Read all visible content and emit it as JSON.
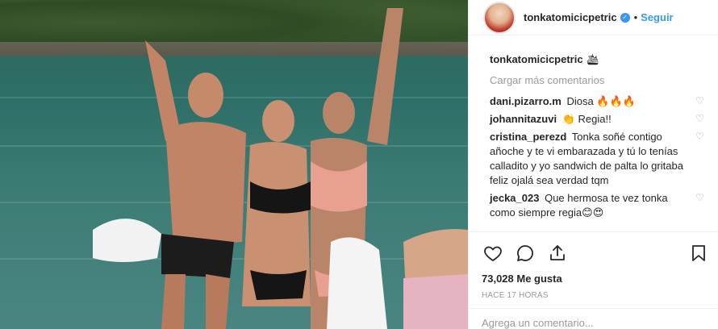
{
  "post": {
    "username": "tonkatomicicpetric",
    "follow_label": "Seguir",
    "dot": "•",
    "caption_username": "tonkatomicicpetric",
    "caption_text": "🛳",
    "load_more": "Cargar más comentarios",
    "comments": [
      {
        "user": "dani.pizarro.m",
        "text": "Diosa 🔥🔥🔥"
      },
      {
        "user": "johannitazuvi",
        "text": "👏 Regia!!"
      },
      {
        "user": "cristina_perezd",
        "text": "Tonka soñé contigo añoche y te vi embarazada y tú lo tenías calladito y yo sandwich de palta lo gritaba feliz ojalá sea verdad tqm"
      },
      {
        "user": "jecka_023",
        "text": "Que hermosa te vez tonka como siempre regia😊😍"
      }
    ],
    "likes": "73,028 Me gusta",
    "time": "HACE 17 HORAS",
    "add_comment_placeholder": "Agrega un comentario..."
  },
  "icons": {
    "verified": "verified-icon",
    "like": "heart-icon",
    "comment": "comment-icon",
    "share": "share-icon",
    "save": "bookmark-icon",
    "comment_like": "heart-icon"
  },
  "colors": {
    "link": "#3897f0",
    "muted": "#999999",
    "text": "#262626",
    "border": "#efefef"
  }
}
